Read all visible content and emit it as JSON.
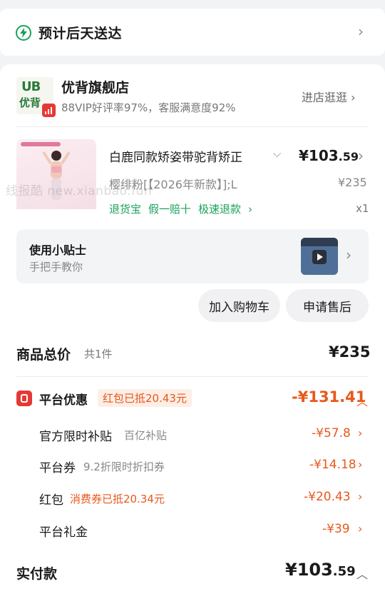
{
  "delivery": {
    "text": "预计后天送达"
  },
  "store": {
    "logo_top": "UB",
    "logo_bottom": "优背",
    "name": "优背旗舰店",
    "rating": "88VIP好评率97%，客服满意度92%",
    "visit": "进店逛逛"
  },
  "product": {
    "title": "白鹿同款矫姿带驼背矫正",
    "price_main": "¥103",
    "price_dec": ".59",
    "sku": "樱绯粉[【2026年新款】];L",
    "orig_price": "¥235",
    "services": [
      "退货宝",
      "假一赔十",
      "极速退款"
    ],
    "qty": "x1"
  },
  "watermark": "线报酷 new.xianbao.fun",
  "tips": {
    "title": "使用小贴士",
    "subtitle": "手把手教你"
  },
  "actions": {
    "add_cart": "加入购物车",
    "after_sale": "申请售后"
  },
  "summary": {
    "total_label": "商品总价",
    "total_count": "共1件",
    "total_value": "¥235"
  },
  "promo": {
    "label": "平台优惠",
    "badge": "红包已抵20.43元",
    "total": "-¥131.41",
    "rows": [
      {
        "label": "官方限时补贴",
        "sub": "百亿补贴",
        "value": "-¥57.8"
      },
      {
        "label": "平台券",
        "sub": "9.2折限时折扣券",
        "value": "-¥14.18"
      },
      {
        "label": "红包",
        "sub": "消费券已抵20.34元",
        "value": "-¥20.43"
      },
      {
        "label": "平台礼金",
        "sub": "",
        "value": "-¥39"
      }
    ]
  },
  "paid": {
    "label": "实付款",
    "main": "¥103",
    "dec": ".59"
  },
  "colors": {
    "accent": "#e8581c",
    "green": "#1aa25a",
    "red": "#e53935"
  }
}
